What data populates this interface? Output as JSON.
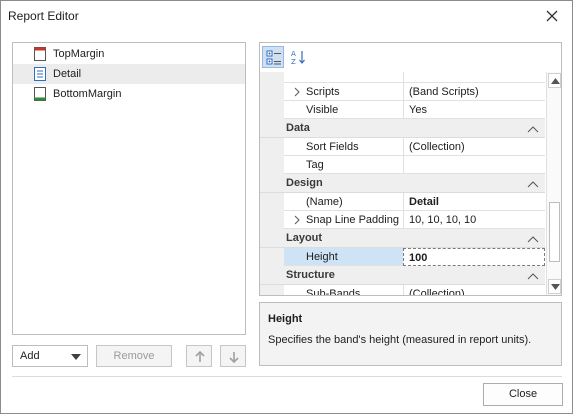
{
  "window": {
    "title": "Report Editor"
  },
  "tree": {
    "items": [
      {
        "label": "TopMargin",
        "icon": "top-margin-band-icon",
        "selected": false
      },
      {
        "label": "Detail",
        "icon": "detail-band-icon",
        "selected": true
      },
      {
        "label": "BottomMargin",
        "icon": "bottom-margin-band-icon",
        "selected": false
      }
    ]
  },
  "controls": {
    "add_label": "Add",
    "remove_label": "Remove"
  },
  "property_grid": {
    "rows": {
      "scripts": {
        "name": "Scripts",
        "value": "(Band Scripts)"
      },
      "visible": {
        "name": "Visible",
        "value": "Yes"
      },
      "sort_fields": {
        "name": "Sort Fields",
        "value": "(Collection)"
      },
      "tag": {
        "name": "Tag",
        "value": ""
      },
      "name": {
        "name": "(Name)",
        "value": "Detail"
      },
      "snap": {
        "name": "Snap Line Padding",
        "value": "10, 10, 10, 10"
      },
      "height": {
        "name": "Height",
        "value": "100"
      },
      "sub_bands": {
        "name": "Sub-Bands",
        "value": "(Collection)"
      }
    },
    "categories": {
      "data": "Data",
      "design": "Design",
      "layout": "Layout",
      "structure": "Structure"
    }
  },
  "description": {
    "title": "Height",
    "text": "Specifies the band's height (measured in report units)."
  },
  "footer": {
    "close_label": "Close"
  },
  "colors": {
    "selection": "#cfe3f7",
    "accent": "#2f6fc0",
    "band_red": "#c0392b",
    "band_green": "#2e8b3a"
  }
}
